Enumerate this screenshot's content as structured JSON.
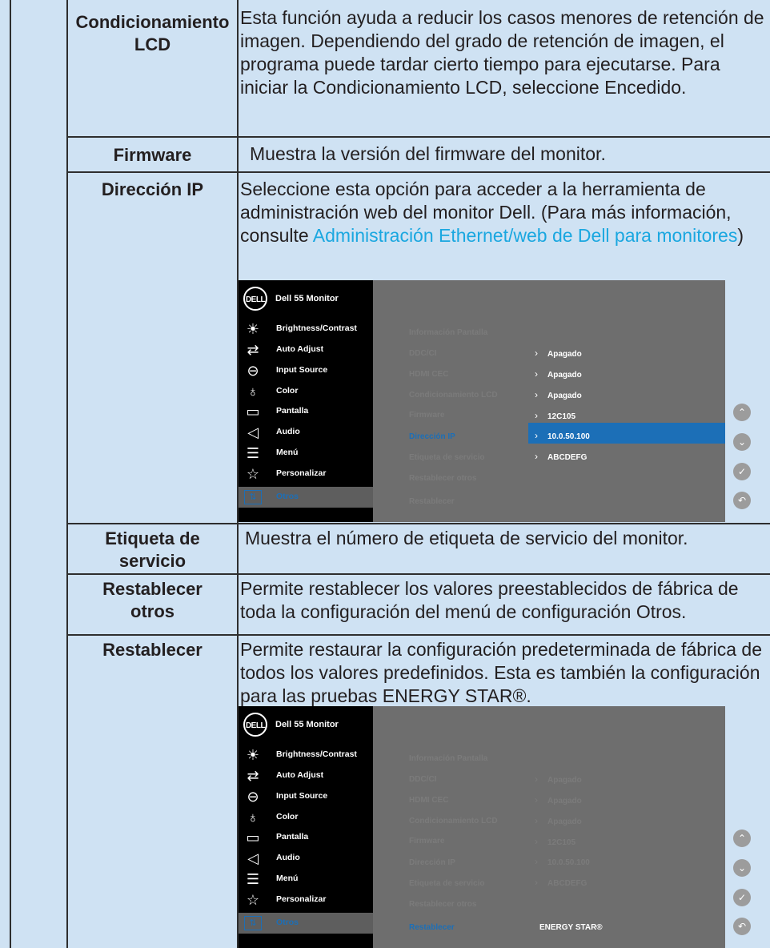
{
  "rows": [
    {
      "label": "Condicionamiento\nLCD",
      "desc": "Esta función ayuda a reducir los casos menores de retención de imagen. Dependiendo del grado de retención de imagen, el programa puede tardar cierto tiempo para ejecutarse. Para iniciar la Condicionamiento LCD, seleccione Encedido."
    },
    {
      "label": "Firmware",
      "desc": "Muestra la versión del firmware del monitor."
    },
    {
      "label": "Dirección IP",
      "desc_pre": "Seleccione esta opción para acceder a la herramienta de administración web del monitor Dell. (Para más información, consulte ",
      "desc_link": "Administración Ethernet/web de Dell para monitores",
      "desc_post": ")"
    },
    {
      "label": "Etiqueta de\nservicio",
      "desc": "Muestra el número de etiqueta de servicio del monitor."
    },
    {
      "label": "Restablecer\notros",
      "desc": "Permite restablecer los valores preestablecidos de fábrica de toda la configuración del menú de configuración Otros."
    },
    {
      "label": "Restablecer",
      "desc": "Permite restaurar la configuración predeterminada de fábrica de todos los valores predefinidos. Esta es también la configuración para las pruebas ENERGY STAR®."
    }
  ],
  "osd": {
    "logo": "DELL",
    "title": "Dell 55 Monitor",
    "menu": [
      {
        "label": "Brightness/Contrast",
        "icon": "brightness-icon"
      },
      {
        "label": "Auto Adjust",
        "icon": "auto-adjust-icon"
      },
      {
        "label": "Input Source",
        "icon": "input-source-icon"
      },
      {
        "label": "Color",
        "icon": "color-icon"
      },
      {
        "label": "Pantalla",
        "icon": "display-icon"
      },
      {
        "label": "Audio",
        "icon": "audio-icon"
      },
      {
        "label": "Menú",
        "icon": "menu-icon"
      },
      {
        "label": "Personalizar",
        "icon": "star-icon"
      },
      {
        "label": "Otros",
        "icon": "others-icon"
      }
    ],
    "options": [
      "Información Pantalla",
      "DDC/CI",
      "HDMI CEC",
      "Condicionamiento LCD",
      "Firmware",
      "Dirección IP",
      "Etiqueta de servicio",
      "Restablecer otros",
      "Restablecer"
    ],
    "values": [
      "Apagado",
      "Apagado",
      "Apagado",
      "12C105",
      "10.0.50.100",
      "ABCDEFG"
    ],
    "energy_star": "ENERGY STAR®",
    "accent": "#1c6fb7"
  }
}
